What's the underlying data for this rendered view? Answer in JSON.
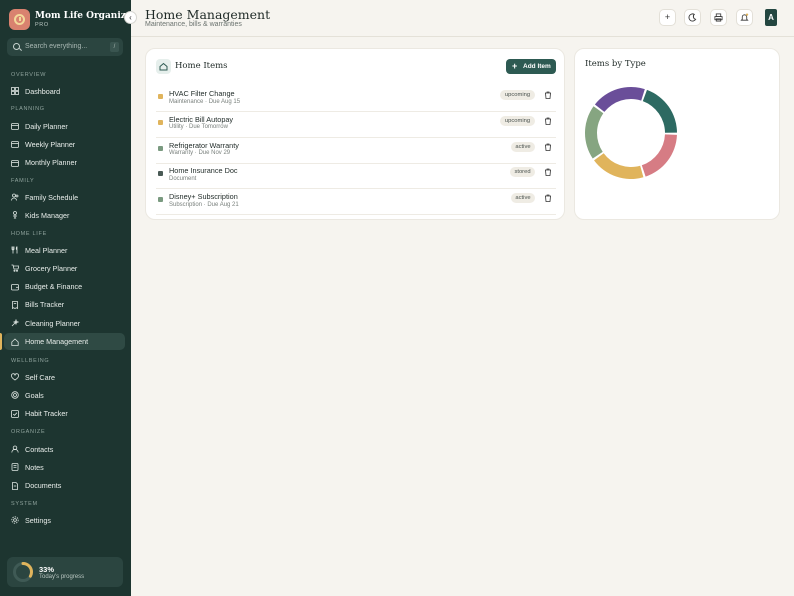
{
  "app": {
    "name": "Mom Life Organizer",
    "tier": "PRO",
    "brand_color": "#1d3530",
    "accent": "#2d5a52"
  },
  "search": {
    "placeholder": "Search everything...",
    "shortcut": "/"
  },
  "sidebar": {
    "sections": [
      {
        "label": "OVERVIEW",
        "items": [
          {
            "label": "Dashboard",
            "icon": "grid-icon"
          }
        ]
      },
      {
        "label": "PLANNING",
        "items": [
          {
            "label": "Daily Planner",
            "icon": "calendar-icon"
          },
          {
            "label": "Weekly Planner",
            "icon": "calendar-icon"
          },
          {
            "label": "Monthly Planner",
            "icon": "calendar-icon"
          }
        ]
      },
      {
        "label": "FAMILY",
        "items": [
          {
            "label": "Family Schedule",
            "icon": "users-icon"
          },
          {
            "label": "Kids Manager",
            "icon": "child-icon"
          }
        ]
      },
      {
        "label": "HOME LIFE",
        "items": [
          {
            "label": "Meal Planner",
            "icon": "utensils-icon"
          },
          {
            "label": "Grocery Planner",
            "icon": "cart-icon"
          },
          {
            "label": "Budget & Finance",
            "icon": "wallet-icon"
          },
          {
            "label": "Bills Tracker",
            "icon": "receipt-icon"
          },
          {
            "label": "Cleaning Planner",
            "icon": "sparkle-icon"
          },
          {
            "label": "Home Management",
            "icon": "home-icon",
            "active": true
          }
        ]
      },
      {
        "label": "WELLBEING",
        "items": [
          {
            "label": "Self Care",
            "icon": "heart-icon"
          },
          {
            "label": "Goals",
            "icon": "target-icon"
          },
          {
            "label": "Habit Tracker",
            "icon": "check-icon"
          }
        ]
      },
      {
        "label": "ORGANIZE",
        "items": [
          {
            "label": "Contacts",
            "icon": "contact-icon"
          },
          {
            "label": "Notes",
            "icon": "note-icon"
          },
          {
            "label": "Documents",
            "icon": "file-icon"
          }
        ]
      },
      {
        "label": "SYSTEM",
        "items": [
          {
            "label": "Settings",
            "icon": "gear-icon"
          }
        ]
      }
    ]
  },
  "progress": {
    "percent_label": "33%",
    "value": 0.33,
    "label": "Today's progress"
  },
  "header": {
    "title": "Home Management",
    "subtitle": "Maintenance, bills & warranties",
    "avatar_initial": "A",
    "actions": [
      "plus-icon",
      "moon-icon",
      "print-icon",
      "bell-icon"
    ]
  },
  "items_card": {
    "title": "Home Items",
    "add_label": "Add Item",
    "items": [
      {
        "name": "HVAC Filter Change",
        "meta": "Maintenance · Due Aug 15",
        "status": "upcoming",
        "color": "#e0b45c"
      },
      {
        "name": "Electric Bill Autopay",
        "meta": "Utility · Due Tomorrow",
        "status": "upcoming",
        "color": "#e0b45c"
      },
      {
        "name": "Refrigerator Warranty",
        "meta": "Warranty · Due Nov 29",
        "status": "active",
        "color": "#7a9a80"
      },
      {
        "name": "Home Insurance Doc",
        "meta": "Document",
        "status": "stored",
        "color": "#4a5a56"
      },
      {
        "name": "Disney+ Subscription",
        "meta": "Subscription · Due Aug 21",
        "status": "active",
        "color": "#7a9a80"
      }
    ]
  },
  "chart_data": {
    "type": "pie",
    "title": "Items by Type",
    "donut": true,
    "series": [
      {
        "value": 1,
        "color": "#2d6a62"
      },
      {
        "value": 1,
        "color": "#d67c84"
      },
      {
        "value": 1,
        "color": "#e0b45c"
      },
      {
        "value": 1,
        "color": "#86a581"
      },
      {
        "value": 1,
        "color": "#6a4e99"
      }
    ]
  }
}
